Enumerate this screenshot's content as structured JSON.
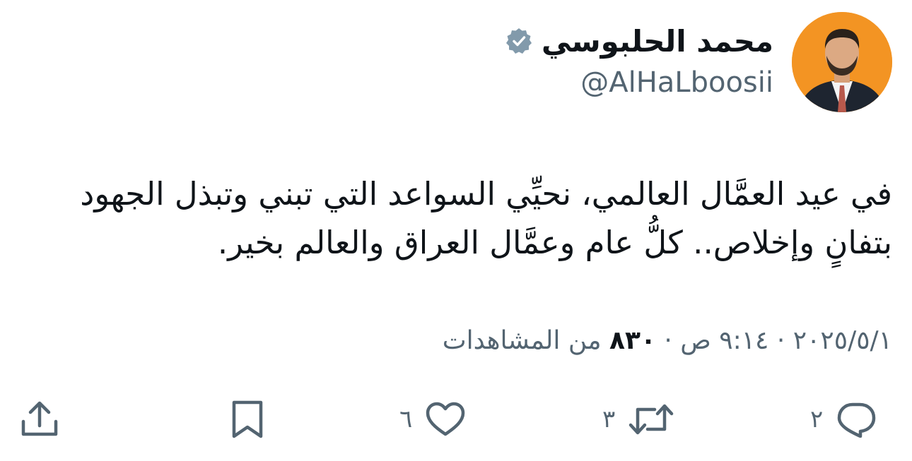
{
  "author": {
    "display_name": "محمد الحلبوسي",
    "handle": "@AlHaLboosii",
    "verified_icon": "verified-badge-icon",
    "avatar_bg": "#f39423"
  },
  "tweet": {
    "lines": [
      "في عيد العمَّال العالمي، نحيِّي السواعد التي تبني وتبذل الجهود",
      "بتفانٍ وإخلاص.. كلُّ عام وعمَّال العراق والعالم بخير."
    ]
  },
  "meta": {
    "date": "٢٠٢٥/٥/١",
    "separator": " · ",
    "time": "٩:١٤ ص",
    "views_count": "٨٣٠",
    "views_label": "من المشاهدات"
  },
  "actions": {
    "replies": "٢",
    "retweets": "٣",
    "likes": "٦",
    "icons": [
      "reply-icon",
      "retweet-icon",
      "like-icon",
      "bookmark-icon",
      "share-icon"
    ]
  },
  "colors": {
    "text_primary": "#0f1419",
    "text_secondary": "#536471",
    "verified_badge": "#829aab"
  }
}
